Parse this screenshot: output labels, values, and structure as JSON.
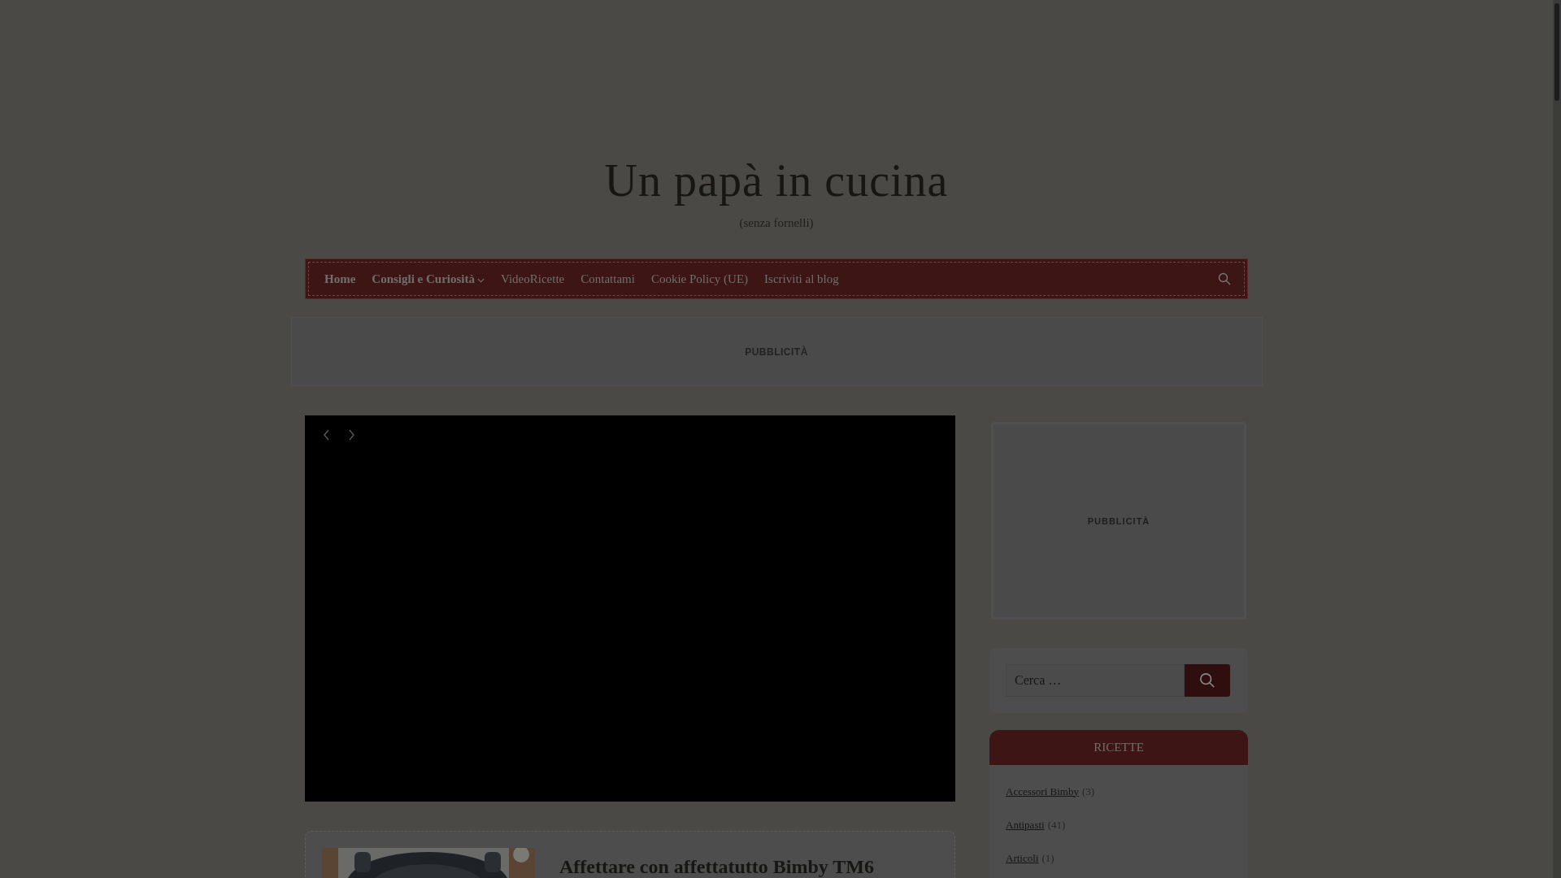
{
  "site": {
    "title": "Un papà in cucina",
    "tagline": "(senza fornelli)"
  },
  "nav": {
    "items": [
      {
        "label": "Home",
        "bold": true,
        "submenu": false
      },
      {
        "label": "Consigli e Curiosità",
        "bold": true,
        "submenu": true
      },
      {
        "label": "VideoRicette",
        "bold": false,
        "submenu": false
      },
      {
        "label": "Contattami",
        "bold": false,
        "submenu": false
      },
      {
        "label": "Cookie Policy (UE)",
        "bold": false,
        "submenu": false
      },
      {
        "label": "Iscriviti al blog",
        "bold": false,
        "submenu": false
      }
    ]
  },
  "ad_banner": {
    "label": "PUBBLICITÀ"
  },
  "slider": {
    "kind": "video"
  },
  "post": {
    "title": "Affettare con affettatutto Bimby TM6"
  },
  "sidebar": {
    "ad": {
      "label": "PUBBLICITÀ"
    },
    "search": {
      "placeholder": "Cerca …"
    },
    "categories": {
      "title": "RICETTE",
      "items": [
        {
          "name": "Accessori Bimby",
          "count": "(3)"
        },
        {
          "name": "Antipasti",
          "count": "(41)"
        },
        {
          "name": "Articoli",
          "count": "(1)"
        }
      ]
    }
  }
}
